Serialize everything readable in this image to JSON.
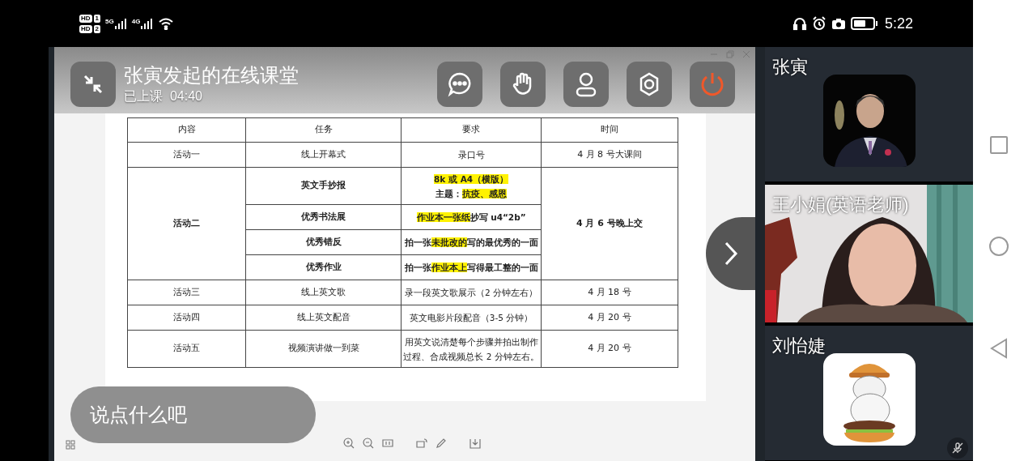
{
  "status_bar": {
    "sim_badges": [
      {
        "label": "HD",
        "slot": "1"
      },
      {
        "label": "HD",
        "slot": "2"
      }
    ],
    "networks": [
      "5G",
      "4G"
    ],
    "time": "5:22"
  },
  "classroom": {
    "title": "张寅发起的在线课堂",
    "elapsed": "已上课  04:40"
  },
  "document": {
    "table": {
      "columns": [
        "内容",
        "任务",
        "要求",
        "时间"
      ],
      "groups": [
        {
          "activity": "活动一",
          "time": "4 月 8 号大课间",
          "bold": false,
          "items": [
            {
              "task": "线上开幕式",
              "requirement": [
                [
                  {
                    "text": "录口号",
                    "highlight": false
                  }
                ]
              ]
            }
          ]
        },
        {
          "activity": "活动二",
          "time": "4 月 6 号晚上交",
          "bold": true,
          "items": [
            {
              "task": "英文手抄报",
              "requirement": [
                [
                  {
                    "text": "8k 或 A4（横版）",
                    "highlight": true
                  }
                ],
                [
                  {
                    "text": "主题：",
                    "highlight": false
                  },
                  {
                    "text": "抗疫、感恩",
                    "highlight": true
                  }
                ]
              ]
            },
            {
              "task": "优秀书法展",
              "requirement": [
                [
                  {
                    "text": "作业本一张纸",
                    "highlight": true
                  },
                  {
                    "text": "抄写 u4“2b”",
                    "highlight": false
                  }
                ]
              ]
            },
            {
              "task": "优秀错反",
              "requirement": [
                [
                  {
                    "text": "拍一张",
                    "highlight": false
                  },
                  {
                    "text": "未批改的",
                    "highlight": true
                  },
                  {
                    "text": "写的最优秀的一面",
                    "highlight": false
                  }
                ]
              ]
            },
            {
              "task": "优秀作业",
              "requirement": [
                [
                  {
                    "text": "拍一张",
                    "highlight": false
                  },
                  {
                    "text": "作业本上",
                    "highlight": true
                  },
                  {
                    "text": "写得最工整的一面",
                    "highlight": false
                  }
                ]
              ]
            }
          ]
        },
        {
          "activity": "活动三",
          "time": "4 月 18 号",
          "bold": false,
          "items": [
            {
              "task": "线上英文歌",
              "requirement": [
                [
                  {
                    "text": "录一段英文歌展示（2 分钟左右）",
                    "highlight": false
                  }
                ]
              ]
            }
          ]
        },
        {
          "activity": "活动四",
          "time": "4 月 20 号",
          "bold": false,
          "items": [
            {
              "task": "线上英文配音",
              "requirement": [
                [
                  {
                    "text": "英文电影片段配音（3-5 分钟）",
                    "highlight": false
                  }
                ]
              ]
            }
          ]
        },
        {
          "activity": "活动五",
          "time": "4 月 20 号",
          "bold": false,
          "items": [
            {
              "task": "视频演讲做一到菜",
              "requirement": [
                [
                  {
                    "text": "用英文说清楚每个步骤并拍出制作",
                    "highlight": false
                  }
                ],
                [
                  {
                    "text": "过程、合成视频总长 2 分钟左右。",
                    "highlight": false
                  }
                ]
              ]
            }
          ]
        }
      ]
    }
  },
  "chat_input": {
    "placeholder": "说点什么吧"
  },
  "participants": [
    {
      "name": "张寅",
      "kind": "portrait",
      "muted": false
    },
    {
      "name": "王小娟(英语老师)",
      "kind": "video",
      "muted": false
    },
    {
      "name": "刘怡婕",
      "kind": "cartoon",
      "muted": true
    }
  ]
}
